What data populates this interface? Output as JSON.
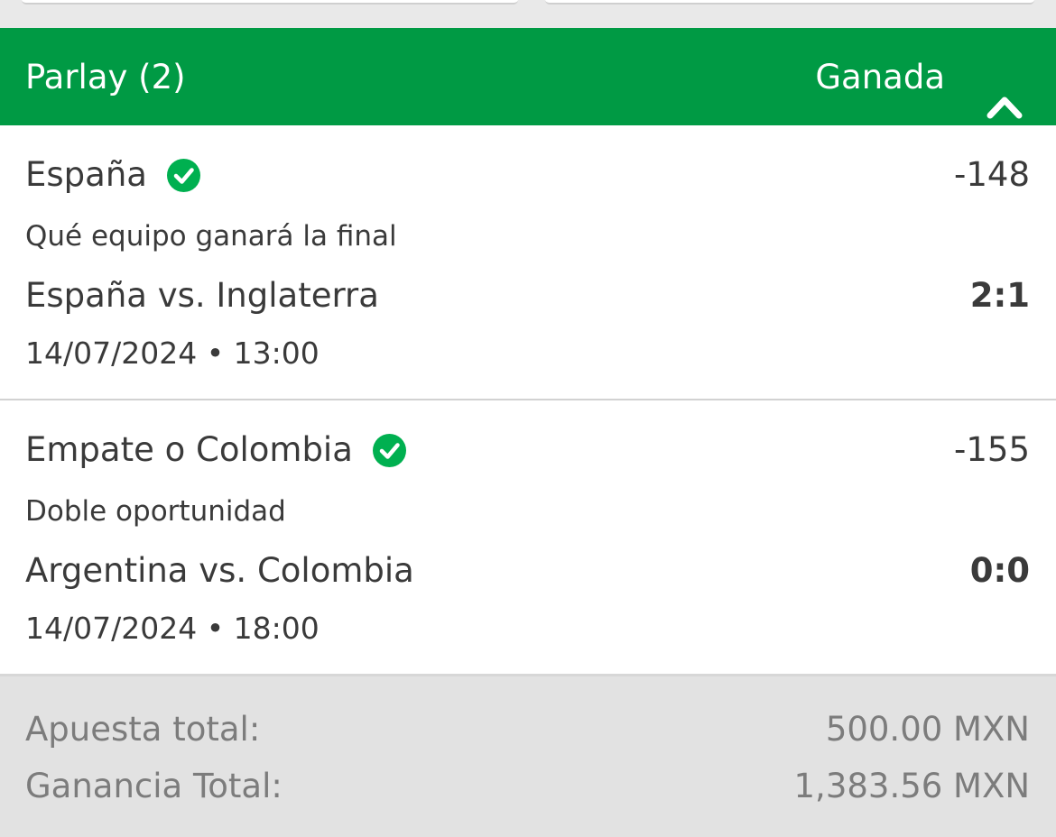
{
  "header": {
    "title": "Parlay (2)",
    "status": "Ganada",
    "color": "#009a44"
  },
  "bets": [
    {
      "selection": "España",
      "odds": "-148",
      "market": "Qué equipo ganará la final",
      "match": "España vs. Inglaterra",
      "score": "2:1",
      "datetime": "14/07/2024 • 13:00",
      "status_icon": "check-circle-icon"
    },
    {
      "selection": "Empate o Colombia",
      "odds": "-155",
      "market": "Doble oportunidad",
      "match": "Argentina vs. Colombia",
      "score": "0:0",
      "datetime": "14/07/2024 • 18:00",
      "status_icon": "check-circle-icon"
    }
  ],
  "summary": {
    "stake_label": "Apuesta total:",
    "stake_value": "500.00 MXN",
    "payout_label": "Ganancia Total:",
    "payout_value": "1,383.56 MXN"
  },
  "colors": {
    "accent_green": "#009a44",
    "check_green": "#00b050"
  }
}
